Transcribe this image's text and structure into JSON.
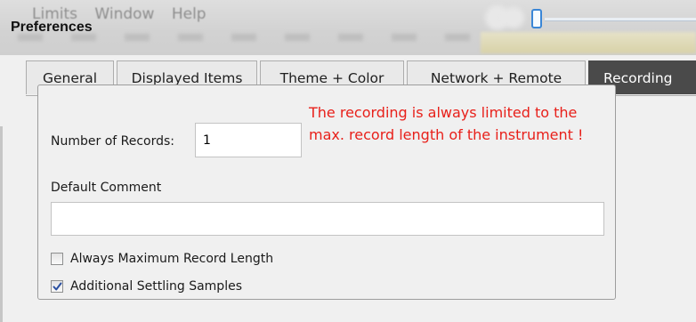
{
  "background": {
    "menu": [
      "Limits",
      "Window",
      "Help"
    ]
  },
  "dialog": {
    "title": "Preferences",
    "tabs": [
      {
        "label": "General",
        "active": false
      },
      {
        "label": "Displayed Items",
        "active": false
      },
      {
        "label": "Theme + Color",
        "active": false
      },
      {
        "label": "Network + Remote",
        "active": false
      },
      {
        "label": "Recording",
        "active": true
      }
    ],
    "records": {
      "label": "Number of Records:",
      "value": "1"
    },
    "warning_lines": [
      "The recording is always limited to the",
      "max. record length of the instrument !"
    ],
    "comment": {
      "label": "Default Comment",
      "value": ""
    },
    "checkboxes": [
      {
        "label": "Always Maximum Record Length",
        "checked": false
      },
      {
        "label": "Additional Settling Samples",
        "checked": true
      }
    ]
  },
  "colors": {
    "warning": "#e8201a",
    "active_tab": "#4a4a4a",
    "check_mark": "#2a4fa0"
  }
}
